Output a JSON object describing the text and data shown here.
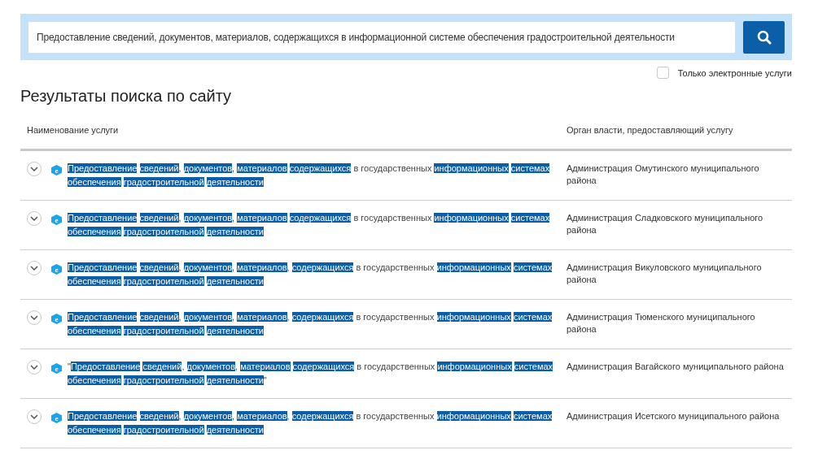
{
  "search": {
    "value": "Предоставление сведений, документов, материалов, содержащихся в информационной системе обеспечения градостроительной деятельности"
  },
  "filter": {
    "label": "Только электронные услуги",
    "checked": false
  },
  "title": "Результаты поиска по сайту",
  "table": {
    "columns": [
      "Наименование услуги",
      "Орган власти, предоставляющий услугу"
    ],
    "rows": [
      {
        "expanded": false,
        "badge": "e",
        "agency": "Администрация Омутинского муниципального района",
        "segments": [
          {
            "text": "Предоставление",
            "highlighted": true,
            "space_after": true
          },
          {
            "text": "сведений",
            "highlighted": true,
            "space_after": false
          },
          {
            "text": ",",
            "highlighted": false,
            "space_after": true
          },
          {
            "text": "документов",
            "highlighted": true,
            "space_after": false
          },
          {
            "text": ",",
            "highlighted": false,
            "space_after": true
          },
          {
            "text": "материалов",
            "highlighted": true,
            "space_after": true
          },
          {
            "text": "содержащихся",
            "highlighted": true,
            "space_after": true
          },
          {
            "text": "в государственных",
            "highlighted": false,
            "space_after": true
          },
          {
            "text": "информационных",
            "highlighted": true,
            "space_after": true
          },
          {
            "text": "системах",
            "highlighted": true,
            "space_after": true
          },
          {
            "text": "обеспечения",
            "highlighted": true,
            "space_after": true
          },
          {
            "text": "градостроительной",
            "highlighted": true,
            "space_after": true
          },
          {
            "text": "деятельности",
            "highlighted": true,
            "space_after": false
          }
        ]
      },
      {
        "expanded": false,
        "badge": "e",
        "agency": "Администрация Сладковского муниципального района",
        "segments": [
          {
            "text": "Предоставление",
            "highlighted": true,
            "space_after": true
          },
          {
            "text": "сведений",
            "highlighted": true,
            "space_after": false
          },
          {
            "text": ",",
            "highlighted": false,
            "space_after": true
          },
          {
            "text": "документов",
            "highlighted": true,
            "space_after": false
          },
          {
            "text": ",",
            "highlighted": false,
            "space_after": true
          },
          {
            "text": "материалов",
            "highlighted": true,
            "space_after": true
          },
          {
            "text": "содержащихся",
            "highlighted": true,
            "space_after": true
          },
          {
            "text": "в государственных",
            "highlighted": false,
            "space_after": true
          },
          {
            "text": "информационных",
            "highlighted": true,
            "space_after": true
          },
          {
            "text": "системах",
            "highlighted": true,
            "space_after": true
          },
          {
            "text": "обеспечения",
            "highlighted": true,
            "space_after": true
          },
          {
            "text": "градостроительной",
            "highlighted": true,
            "space_after": true
          },
          {
            "text": "деятельности",
            "highlighted": true,
            "space_after": false
          }
        ]
      },
      {
        "expanded": false,
        "badge": "e",
        "agency": "Администрация Викуловского муниципального района",
        "segments": [
          {
            "text": "Предоставление",
            "highlighted": true,
            "space_after": true
          },
          {
            "text": "сведений",
            "highlighted": true,
            "space_after": false
          },
          {
            "text": ",",
            "highlighted": false,
            "space_after": true
          },
          {
            "text": "документов",
            "highlighted": true,
            "space_after": false
          },
          {
            "text": ",",
            "highlighted": false,
            "space_after": true
          },
          {
            "text": "материалов",
            "highlighted": true,
            "space_after": false
          },
          {
            "text": ",",
            "highlighted": false,
            "space_after": true
          },
          {
            "text": "содержащихся",
            "highlighted": true,
            "space_after": true
          },
          {
            "text": "в государственных",
            "highlighted": false,
            "space_after": true
          },
          {
            "text": "информационных",
            "highlighted": true,
            "space_after": true
          },
          {
            "text": "системах",
            "highlighted": true,
            "space_after": true
          },
          {
            "text": "обеспечения",
            "highlighted": true,
            "space_after": true
          },
          {
            "text": "градостроительной",
            "highlighted": true,
            "space_after": true
          },
          {
            "text": "деятельности",
            "highlighted": true,
            "space_after": false
          }
        ]
      },
      {
        "expanded": false,
        "badge": "e",
        "agency": "Администрация Тюменского муниципального района",
        "segments": [
          {
            "text": "Предоставление",
            "highlighted": true,
            "space_after": true
          },
          {
            "text": "сведений",
            "highlighted": true,
            "space_after": false
          },
          {
            "text": ",",
            "highlighted": false,
            "space_after": true
          },
          {
            "text": "документов",
            "highlighted": true,
            "space_after": false
          },
          {
            "text": ",",
            "highlighted": false,
            "space_after": true
          },
          {
            "text": "материалов",
            "highlighted": true,
            "space_after": false
          },
          {
            "text": ",",
            "highlighted": false,
            "space_after": true
          },
          {
            "text": "содержащихся",
            "highlighted": true,
            "space_after": true
          },
          {
            "text": "в государственных",
            "highlighted": false,
            "space_after": true
          },
          {
            "text": "информационных",
            "highlighted": true,
            "space_after": true
          },
          {
            "text": "системах",
            "highlighted": true,
            "space_after": true
          },
          {
            "text": "обеспечения",
            "highlighted": true,
            "space_after": true
          },
          {
            "text": "градостроительной",
            "highlighted": true,
            "space_after": true
          },
          {
            "text": "деятельности",
            "highlighted": true,
            "space_after": false
          }
        ]
      },
      {
        "expanded": false,
        "badge": "e",
        "agency": "Администрация Вагайского муниципального района",
        "segments": [
          {
            "text": "\"",
            "highlighted": false,
            "space_after": false
          },
          {
            "text": "Предоставление",
            "highlighted": true,
            "space_after": true
          },
          {
            "text": "сведений",
            "highlighted": true,
            "space_after": false
          },
          {
            "text": ",",
            "highlighted": false,
            "space_after": true
          },
          {
            "text": "документов",
            "highlighted": true,
            "space_after": false
          },
          {
            "text": ",",
            "highlighted": false,
            "space_after": true
          },
          {
            "text": "материалов",
            "highlighted": true,
            "space_after": true
          },
          {
            "text": "содержащихся",
            "highlighted": true,
            "space_after": true
          },
          {
            "text": "в государственных",
            "highlighted": false,
            "space_after": true
          },
          {
            "text": "информационных",
            "highlighted": true,
            "space_after": true
          },
          {
            "text": "системах",
            "highlighted": true,
            "space_after": true
          },
          {
            "text": "обеспечения",
            "highlighted": true,
            "space_after": true
          },
          {
            "text": "градостроительной",
            "highlighted": true,
            "space_after": true
          },
          {
            "text": "деятельности",
            "highlighted": true,
            "space_after": false
          },
          {
            "text": "\"",
            "highlighted": false,
            "space_after": false
          }
        ]
      },
      {
        "expanded": false,
        "badge": "e",
        "agency": "Администрация Исетского муниципального района",
        "segments": [
          {
            "text": "Предоставление",
            "highlighted": true,
            "space_after": true
          },
          {
            "text": "сведений",
            "highlighted": true,
            "space_after": false
          },
          {
            "text": ",",
            "highlighted": false,
            "space_after": true
          },
          {
            "text": "документов",
            "highlighted": true,
            "space_after": false
          },
          {
            "text": ",",
            "highlighted": false,
            "space_after": true
          },
          {
            "text": "материалов",
            "highlighted": true,
            "space_after": false
          },
          {
            "text": ",",
            "highlighted": false,
            "space_after": true
          },
          {
            "text": "содержащихся",
            "highlighted": true,
            "space_after": true
          },
          {
            "text": "в государственных",
            "highlighted": false,
            "space_after": true
          },
          {
            "text": "информационных",
            "highlighted": true,
            "space_after": true
          },
          {
            "text": "системах",
            "highlighted": true,
            "space_after": true
          },
          {
            "text": "обеспечения",
            "highlighted": true,
            "space_after": true
          },
          {
            "text": "градостроительной",
            "highlighted": true,
            "space_after": true
          },
          {
            "text": "деятельности",
            "highlighted": true,
            "space_after": false
          }
        ]
      }
    ]
  }
}
